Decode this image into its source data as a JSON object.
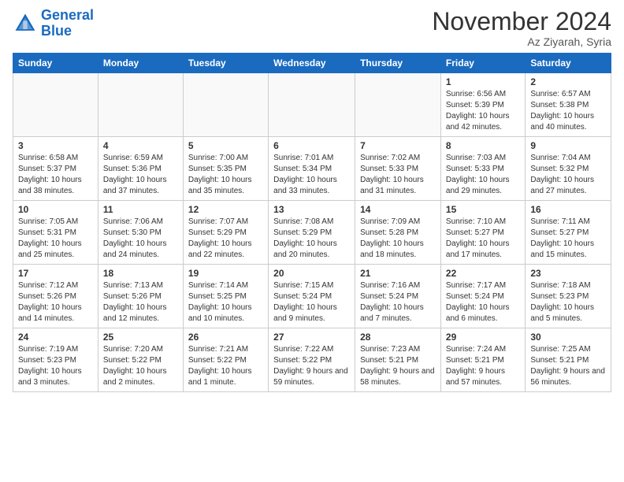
{
  "header": {
    "logo_line1": "General",
    "logo_line2": "Blue",
    "month_title": "November 2024",
    "location": "Az Ziyarah, Syria"
  },
  "weekdays": [
    "Sunday",
    "Monday",
    "Tuesday",
    "Wednesday",
    "Thursday",
    "Friday",
    "Saturday"
  ],
  "weeks": [
    [
      {
        "day": "",
        "sunrise": "",
        "sunset": "",
        "daylight": ""
      },
      {
        "day": "",
        "sunrise": "",
        "sunset": "",
        "daylight": ""
      },
      {
        "day": "",
        "sunrise": "",
        "sunset": "",
        "daylight": ""
      },
      {
        "day": "",
        "sunrise": "",
        "sunset": "",
        "daylight": ""
      },
      {
        "day": "",
        "sunrise": "",
        "sunset": "",
        "daylight": ""
      },
      {
        "day": "1",
        "sunrise": "Sunrise: 6:56 AM",
        "sunset": "Sunset: 5:39 PM",
        "daylight": "Daylight: 10 hours and 42 minutes."
      },
      {
        "day": "2",
        "sunrise": "Sunrise: 6:57 AM",
        "sunset": "Sunset: 5:38 PM",
        "daylight": "Daylight: 10 hours and 40 minutes."
      }
    ],
    [
      {
        "day": "3",
        "sunrise": "Sunrise: 6:58 AM",
        "sunset": "Sunset: 5:37 PM",
        "daylight": "Daylight: 10 hours and 38 minutes."
      },
      {
        "day": "4",
        "sunrise": "Sunrise: 6:59 AM",
        "sunset": "Sunset: 5:36 PM",
        "daylight": "Daylight: 10 hours and 37 minutes."
      },
      {
        "day": "5",
        "sunrise": "Sunrise: 7:00 AM",
        "sunset": "Sunset: 5:35 PM",
        "daylight": "Daylight: 10 hours and 35 minutes."
      },
      {
        "day": "6",
        "sunrise": "Sunrise: 7:01 AM",
        "sunset": "Sunset: 5:34 PM",
        "daylight": "Daylight: 10 hours and 33 minutes."
      },
      {
        "day": "7",
        "sunrise": "Sunrise: 7:02 AM",
        "sunset": "Sunset: 5:33 PM",
        "daylight": "Daylight: 10 hours and 31 minutes."
      },
      {
        "day": "8",
        "sunrise": "Sunrise: 7:03 AM",
        "sunset": "Sunset: 5:33 PM",
        "daylight": "Daylight: 10 hours and 29 minutes."
      },
      {
        "day": "9",
        "sunrise": "Sunrise: 7:04 AM",
        "sunset": "Sunset: 5:32 PM",
        "daylight": "Daylight: 10 hours and 27 minutes."
      }
    ],
    [
      {
        "day": "10",
        "sunrise": "Sunrise: 7:05 AM",
        "sunset": "Sunset: 5:31 PM",
        "daylight": "Daylight: 10 hours and 25 minutes."
      },
      {
        "day": "11",
        "sunrise": "Sunrise: 7:06 AM",
        "sunset": "Sunset: 5:30 PM",
        "daylight": "Daylight: 10 hours and 24 minutes."
      },
      {
        "day": "12",
        "sunrise": "Sunrise: 7:07 AM",
        "sunset": "Sunset: 5:29 PM",
        "daylight": "Daylight: 10 hours and 22 minutes."
      },
      {
        "day": "13",
        "sunrise": "Sunrise: 7:08 AM",
        "sunset": "Sunset: 5:29 PM",
        "daylight": "Daylight: 10 hours and 20 minutes."
      },
      {
        "day": "14",
        "sunrise": "Sunrise: 7:09 AM",
        "sunset": "Sunset: 5:28 PM",
        "daylight": "Daylight: 10 hours and 18 minutes."
      },
      {
        "day": "15",
        "sunrise": "Sunrise: 7:10 AM",
        "sunset": "Sunset: 5:27 PM",
        "daylight": "Daylight: 10 hours and 17 minutes."
      },
      {
        "day": "16",
        "sunrise": "Sunrise: 7:11 AM",
        "sunset": "Sunset: 5:27 PM",
        "daylight": "Daylight: 10 hours and 15 minutes."
      }
    ],
    [
      {
        "day": "17",
        "sunrise": "Sunrise: 7:12 AM",
        "sunset": "Sunset: 5:26 PM",
        "daylight": "Daylight: 10 hours and 14 minutes."
      },
      {
        "day": "18",
        "sunrise": "Sunrise: 7:13 AM",
        "sunset": "Sunset: 5:26 PM",
        "daylight": "Daylight: 10 hours and 12 minutes."
      },
      {
        "day": "19",
        "sunrise": "Sunrise: 7:14 AM",
        "sunset": "Sunset: 5:25 PM",
        "daylight": "Daylight: 10 hours and 10 minutes."
      },
      {
        "day": "20",
        "sunrise": "Sunrise: 7:15 AM",
        "sunset": "Sunset: 5:24 PM",
        "daylight": "Daylight: 10 hours and 9 minutes."
      },
      {
        "day": "21",
        "sunrise": "Sunrise: 7:16 AM",
        "sunset": "Sunset: 5:24 PM",
        "daylight": "Daylight: 10 hours and 7 minutes."
      },
      {
        "day": "22",
        "sunrise": "Sunrise: 7:17 AM",
        "sunset": "Sunset: 5:24 PM",
        "daylight": "Daylight: 10 hours and 6 minutes."
      },
      {
        "day": "23",
        "sunrise": "Sunrise: 7:18 AM",
        "sunset": "Sunset: 5:23 PM",
        "daylight": "Daylight: 10 hours and 5 minutes."
      }
    ],
    [
      {
        "day": "24",
        "sunrise": "Sunrise: 7:19 AM",
        "sunset": "Sunset: 5:23 PM",
        "daylight": "Daylight: 10 hours and 3 minutes."
      },
      {
        "day": "25",
        "sunrise": "Sunrise: 7:20 AM",
        "sunset": "Sunset: 5:22 PM",
        "daylight": "Daylight: 10 hours and 2 minutes."
      },
      {
        "day": "26",
        "sunrise": "Sunrise: 7:21 AM",
        "sunset": "Sunset: 5:22 PM",
        "daylight": "Daylight: 10 hours and 1 minute."
      },
      {
        "day": "27",
        "sunrise": "Sunrise: 7:22 AM",
        "sunset": "Sunset: 5:22 PM",
        "daylight": "Daylight: 9 hours and 59 minutes."
      },
      {
        "day": "28",
        "sunrise": "Sunrise: 7:23 AM",
        "sunset": "Sunset: 5:21 PM",
        "daylight": "Daylight: 9 hours and 58 minutes."
      },
      {
        "day": "29",
        "sunrise": "Sunrise: 7:24 AM",
        "sunset": "Sunset: 5:21 PM",
        "daylight": "Daylight: 9 hours and 57 minutes."
      },
      {
        "day": "30",
        "sunrise": "Sunrise: 7:25 AM",
        "sunset": "Sunset: 5:21 PM",
        "daylight": "Daylight: 9 hours and 56 minutes."
      }
    ]
  ]
}
